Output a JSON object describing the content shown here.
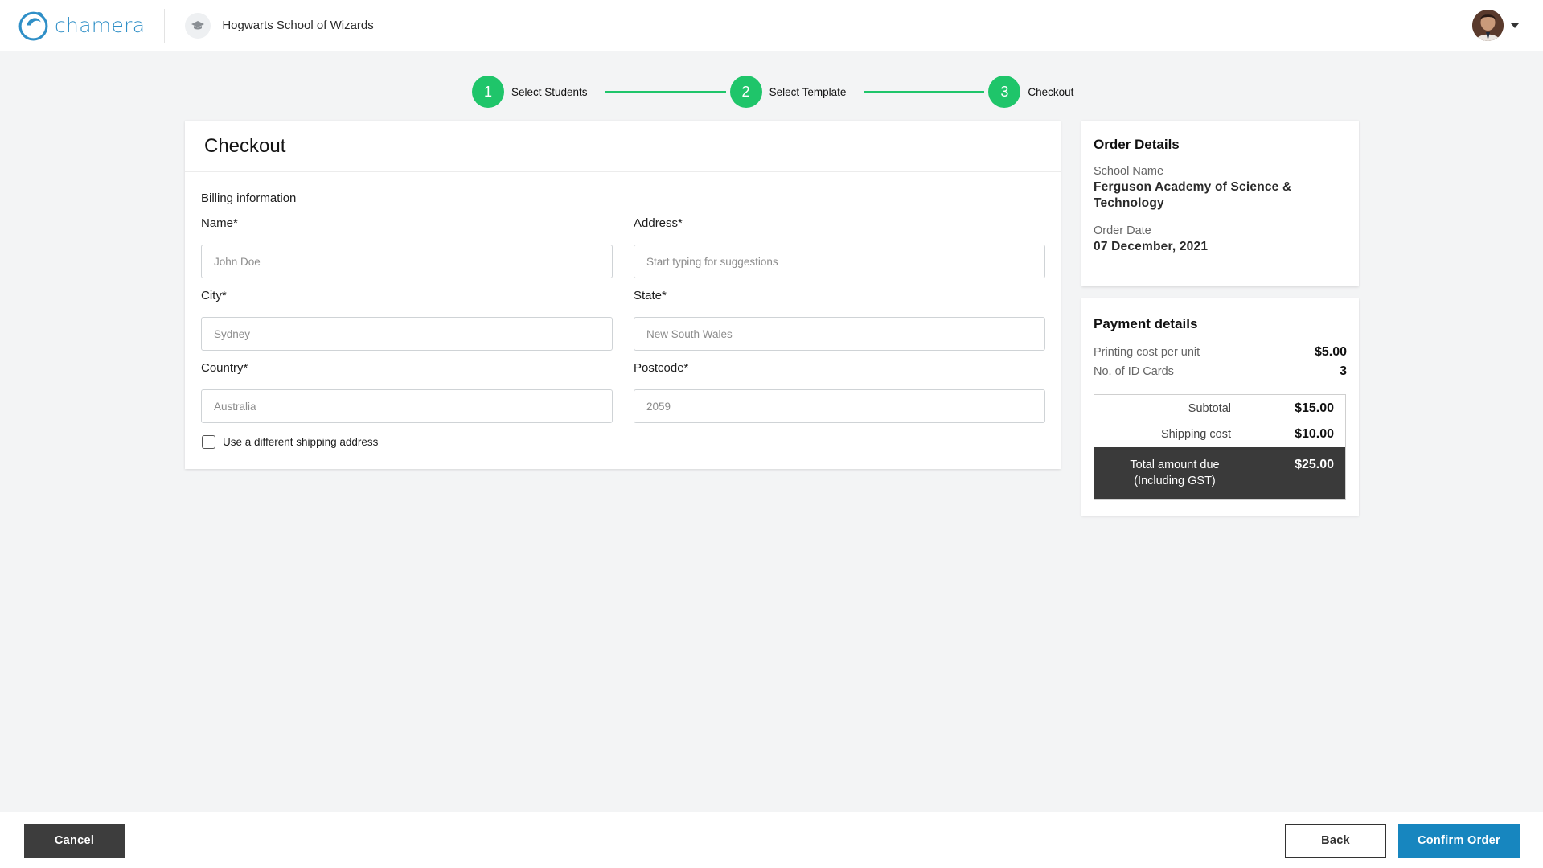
{
  "header": {
    "brand_name": "chamera",
    "school_name": "Hogwarts School of Wizards"
  },
  "stepper": {
    "steps": [
      {
        "number": "1",
        "label": "Select Students"
      },
      {
        "number": "2",
        "label": "Select Template"
      },
      {
        "number": "3",
        "label": "Checkout"
      }
    ],
    "color": "#1fc56a"
  },
  "checkout": {
    "title": "Checkout",
    "section_title": "Billing information",
    "fields": {
      "name": {
        "label": "Name*",
        "placeholder": "John Doe"
      },
      "address": {
        "label": "Address*",
        "placeholder": "Start typing for suggestions"
      },
      "city": {
        "label": "City*",
        "placeholder": "Sydney"
      },
      "state": {
        "label": "State*",
        "placeholder": "New South Wales"
      },
      "country": {
        "label": "Country*",
        "placeholder": "Australia"
      },
      "postcode": {
        "label": "Postcode*",
        "placeholder": "2059"
      }
    },
    "shipping_checkbox_label": "Use a different shipping address"
  },
  "order_details": {
    "title": "Order Details",
    "school_name_label": "School Name",
    "school_name_value": "Ferguson Academy of Science & Technology",
    "order_date_label": "Order Date",
    "order_date_value": "07 December, 2021"
  },
  "payment": {
    "title": "Payment details",
    "printing_cost_label": "Printing cost per unit",
    "printing_cost_value": "$5.00",
    "id_cards_label": "No. of ID Cards",
    "id_cards_value": "3",
    "subtotal_label": "Subtotal",
    "subtotal_value": "$15.00",
    "shipping_label": "Shipping cost",
    "shipping_value": "$10.00",
    "total_label_line1": "Total amount due",
    "total_label_line2": "(Including GST)",
    "total_value": "$25.00"
  },
  "footer": {
    "cancel_label": "Cancel",
    "back_label": "Back",
    "confirm_label": "Confirm Order"
  },
  "colors": {
    "accent_green": "#1fc56a",
    "confirm_blue": "#1786bf",
    "brand_blue": "#2f8fc7"
  }
}
